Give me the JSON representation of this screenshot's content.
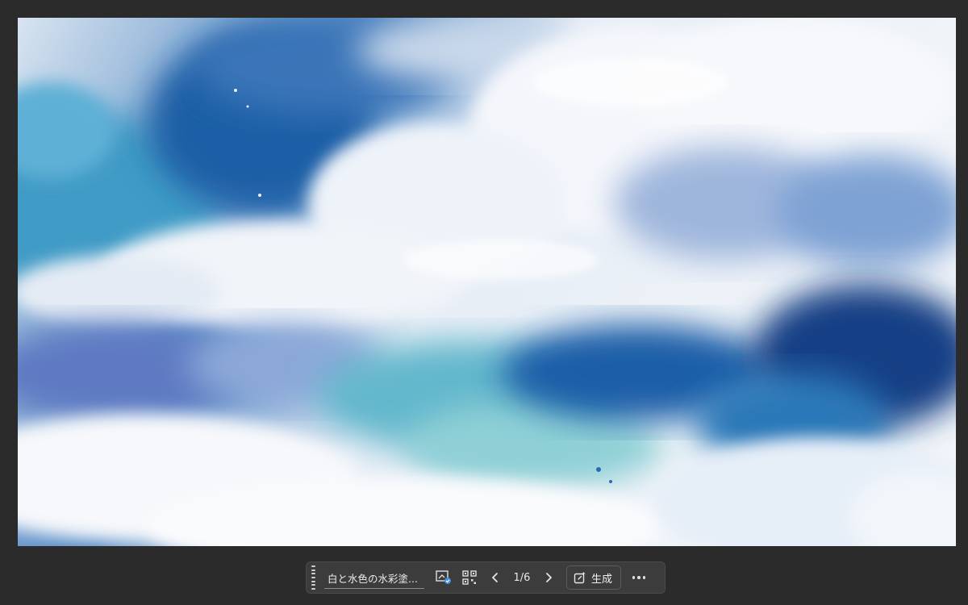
{
  "canvas": {
    "background": "#2b2b2b"
  },
  "image": {
    "icon": "watercolor-clouds-image"
  },
  "context_bar": {
    "prompt_text": "白と水色の水彩塗...",
    "variation_counter": "1/6",
    "generate_label": "生成",
    "icons": {
      "grip": "drag-handle-icon",
      "similar": "generate-similar-icon",
      "qr": "variations-grid-icon",
      "prev": "chevron-left-icon",
      "next": "chevron-right-icon",
      "generate": "generate-icon",
      "more": "more-horizontal-icon"
    },
    "colors": {
      "bar_bg": "#3c3c3c",
      "badge": "#4a90e2"
    }
  }
}
